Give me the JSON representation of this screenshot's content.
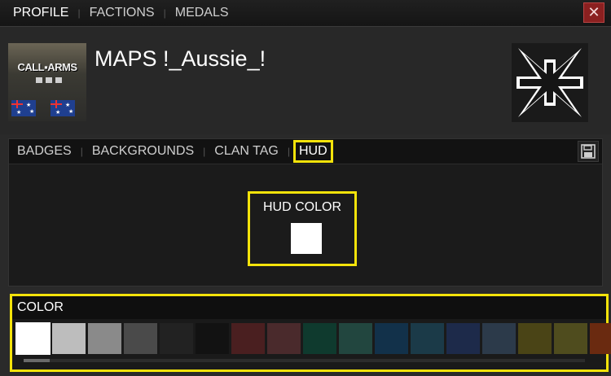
{
  "top_tabs": [
    {
      "label": "PROFILE",
      "active": true
    },
    {
      "label": "FACTIONS",
      "active": false
    },
    {
      "label": "MEDALS",
      "active": false
    }
  ],
  "close_label": "✕",
  "profile": {
    "name": "MAPS !_Aussie_!",
    "logo_text": "CALL▪ARMS"
  },
  "sub_tabs": [
    {
      "label": "BADGES"
    },
    {
      "label": "BACKGROUNDS"
    },
    {
      "label": "CLAN TAG"
    },
    {
      "label": "HUD",
      "active": true
    }
  ],
  "hud": {
    "label": "HUD COLOR",
    "current_color": "#ffffff"
  },
  "palette": {
    "title": "COLOR",
    "colors": [
      "#ffffff",
      "#bdbdbd",
      "#8a8a8a",
      "#4a4a4a",
      "#222222",
      "#121212",
      "#4a1f20",
      "#4a2a2c",
      "#0f3a2e",
      "#22463f",
      "#12314a",
      "#1b3a48",
      "#1d2a4a",
      "#2c3a4a",
      "#4a4416",
      "#4f4c1e",
      "#6a2a10"
    ],
    "selected_index": 0
  },
  "accent_color": "#f4e30a",
  "icons": [
    "close-icon",
    "save-icon",
    "iron-cross-icon"
  ]
}
